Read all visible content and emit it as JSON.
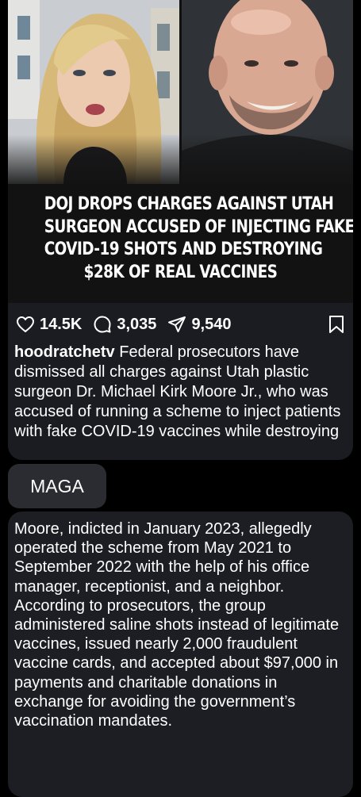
{
  "post": {
    "headline_lines": [
      "DOJ DROPS CHARGES AGAINST UTAH",
      "SURGEON ACCUSED OF INJECTING FAKE",
      "COVID-19 SHOTS AND DESTROYING",
      "$28K OF REAL VACCINES"
    ],
    "likes": "14.5K",
    "comments": "3,035",
    "shares": "9,540",
    "username": "hoodratchetv",
    "caption": " Federal prosecutors have dismissed all charges against Utah plastic surgeon Dr. Michael Kirk Moore Jr., who was accused of running a scheme to inject patients with fake COVID-19 vaccines while destroying"
  },
  "reply_tag": "MAGA",
  "expanded_text": "Moore, indicted in January 2023, allegedly operated the scheme from May 2021 to September 2022 with the help of his office manager, receptionist, and a neighbor. According to prosecutors, the group administered saline shots instead of legitimate vaccines, issued nearly 2,000 fraudulent vaccine cards, and accepted about $97,000 in payments and charitable donations in exchange for avoiding the government’s vaccination mandates.",
  "icons": {
    "like": "heart-icon",
    "comment": "comment-bubble-icon",
    "share": "send-icon",
    "save": "bookmark-icon"
  }
}
